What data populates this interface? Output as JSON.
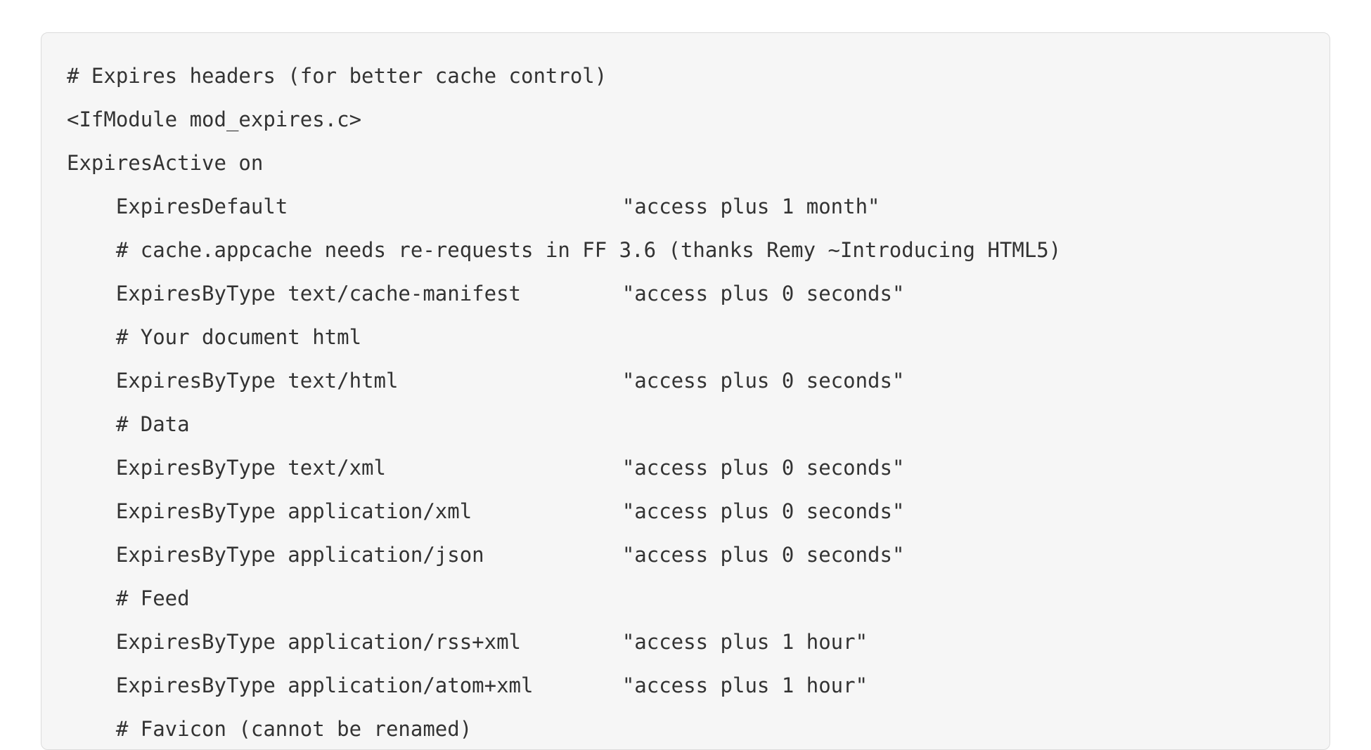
{
  "code": {
    "indent": "    ",
    "lines": [
      {
        "kind": "plain",
        "text": "# Expires headers (for better cache control)"
      },
      {
        "kind": "plain",
        "text": "<IfModule mod_expires.c>"
      },
      {
        "kind": "plain",
        "text": "ExpiresActive on"
      },
      {
        "kind": "kv",
        "indent": 1,
        "left": "ExpiresDefault",
        "right": "\"access plus 1 month\""
      },
      {
        "kind": "plain",
        "indent": 1,
        "text": "# cache.appcache needs re-requests in FF 3.6 (thanks Remy ~Introducing HTML5)"
      },
      {
        "kind": "kv",
        "indent": 1,
        "left": "ExpiresByType text/cache-manifest",
        "right": "\"access plus 0 seconds\""
      },
      {
        "kind": "plain",
        "indent": 1,
        "text": "# Your document html"
      },
      {
        "kind": "kv",
        "indent": 1,
        "left": "ExpiresByType text/html",
        "right": "\"access plus 0 seconds\""
      },
      {
        "kind": "plain",
        "indent": 1,
        "text": "# Data"
      },
      {
        "kind": "kv",
        "indent": 1,
        "left": "ExpiresByType text/xml",
        "right": "\"access plus 0 seconds\""
      },
      {
        "kind": "kv",
        "indent": 1,
        "left": "ExpiresByType application/xml",
        "right": "\"access plus 0 seconds\""
      },
      {
        "kind": "kv",
        "indent": 1,
        "left": "ExpiresByType application/json",
        "right": "\"access plus 0 seconds\""
      },
      {
        "kind": "plain",
        "indent": 1,
        "text": "# Feed"
      },
      {
        "kind": "kv",
        "indent": 1,
        "left": "ExpiresByType application/rss+xml",
        "right": "\"access plus 1 hour\""
      },
      {
        "kind": "kv",
        "indent": 1,
        "left": "ExpiresByType application/atom+xml",
        "right": "\"access plus 1 hour\""
      },
      {
        "kind": "plain",
        "indent": 1,
        "text": "# Favicon (cannot be renamed)"
      }
    ]
  }
}
